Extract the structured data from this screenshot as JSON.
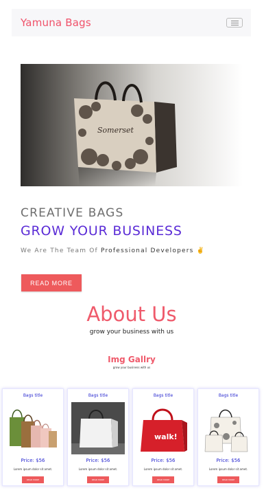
{
  "navbar": {
    "brand": "Yamuna Bags",
    "toggle_icon": "hamburger-icon"
  },
  "hero": {
    "image_icon": "shopping-bag-photo",
    "heading_small": "CREATIVE BAGS",
    "heading_large": "GROW YOUR BUSINESS",
    "tagline_prefix": "We Are The Team Of",
    "tagline_bold": "Professional Developers",
    "tagline_emoji": "✌️",
    "cta_label": "READ MORE"
  },
  "about": {
    "title": "About Us",
    "subtitle": "grow your business with us"
  },
  "gallery": {
    "title": "Img Gallry",
    "subtitle": "grow your business with us",
    "cards": [
      {
        "title": "Bags title",
        "price": "Price: $56",
        "desc": "Lorem ipsum dolor sit amet.",
        "button": "READ MORE"
      },
      {
        "title": "Bags title",
        "price": "Price: $56",
        "desc": "Lorem ipsum dolor sit amet.",
        "button": "READ MORE"
      },
      {
        "title": "Bags title",
        "price": "Price: $56",
        "desc": "Lorem ipsum dolor sit amet.",
        "button": "READ MORE"
      },
      {
        "title": "Bags title",
        "price": "Price: $56",
        "desc": "Lorem ipsum dolor sit amet.",
        "button": "READ MORE"
      }
    ],
    "walk_label": "walk!"
  },
  "colors": {
    "accent": "#ee5a5c",
    "brand": "#f0526a",
    "heading_purple": "#5a2bd6",
    "card_blue": "#2a2ad0"
  }
}
